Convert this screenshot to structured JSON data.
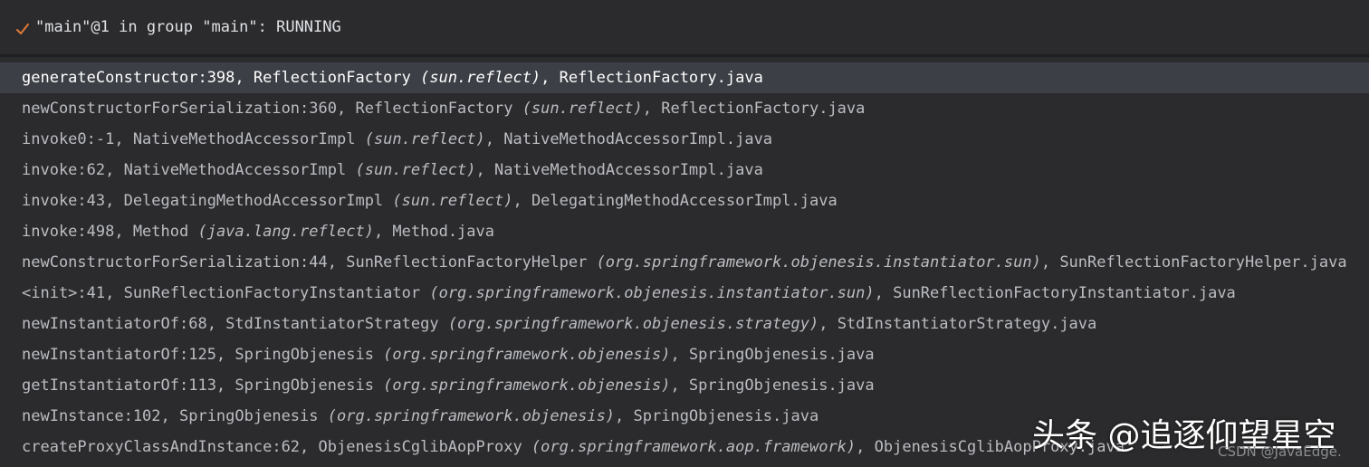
{
  "thread": {
    "icon": "check-icon",
    "label": "\"main\"@1 in group \"main\": RUNNING"
  },
  "colors": {
    "background": "#2b2b2d",
    "selected_row": "#3c3f45",
    "text": "#bbbdc2",
    "check_icon": "#e07a3a"
  },
  "frames": [
    {
      "method": "generateConstructor:398, ReflectionFactory ",
      "package": "(sun.reflect)",
      "file": ", ReflectionFactory.java"
    },
    {
      "method": "newConstructorForSerialization:360, ReflectionFactory ",
      "package": "(sun.reflect)",
      "file": ", ReflectionFactory.java"
    },
    {
      "method": "invoke0:-1, NativeMethodAccessorImpl ",
      "package": "(sun.reflect)",
      "file": ", NativeMethodAccessorImpl.java"
    },
    {
      "method": "invoke:62, NativeMethodAccessorImpl ",
      "package": "(sun.reflect)",
      "file": ", NativeMethodAccessorImpl.java"
    },
    {
      "method": "invoke:43, DelegatingMethodAccessorImpl ",
      "package": "(sun.reflect)",
      "file": ", DelegatingMethodAccessorImpl.java"
    },
    {
      "method": "invoke:498, Method ",
      "package": "(java.lang.reflect)",
      "file": ", Method.java"
    },
    {
      "method": "newConstructorForSerialization:44, SunReflectionFactoryHelper ",
      "package": "(org.springframework.objenesis.instantiator.sun)",
      "file": ", SunReflectionFactoryHelper.java"
    },
    {
      "method": "<init>:41, SunReflectionFactoryInstantiator ",
      "package": "(org.springframework.objenesis.instantiator.sun)",
      "file": ", SunReflectionFactoryInstantiator.java"
    },
    {
      "method": "newInstantiatorOf:68, StdInstantiatorStrategy ",
      "package": "(org.springframework.objenesis.strategy)",
      "file": ", StdInstantiatorStrategy.java"
    },
    {
      "method": "newInstantiatorOf:125, SpringObjenesis ",
      "package": "(org.springframework.objenesis)",
      "file": ", SpringObjenesis.java"
    },
    {
      "method": "getInstantiatorOf:113, SpringObjenesis ",
      "package": "(org.springframework.objenesis)",
      "file": ", SpringObjenesis.java"
    },
    {
      "method": "newInstance:102, SpringObjenesis ",
      "package": "(org.springframework.objenesis)",
      "file": ", SpringObjenesis.java"
    },
    {
      "method": "createProxyClassAndInstance:62, ObjenesisCglibAopProxy ",
      "package": "(org.springframework.aop.framework)",
      "file": ", ObjenesisCglibAopProxy.java"
    }
  ],
  "watermark": {
    "main": "头条 @追逐仰望星空",
    "sub": "CSDN @JavaEdge."
  }
}
